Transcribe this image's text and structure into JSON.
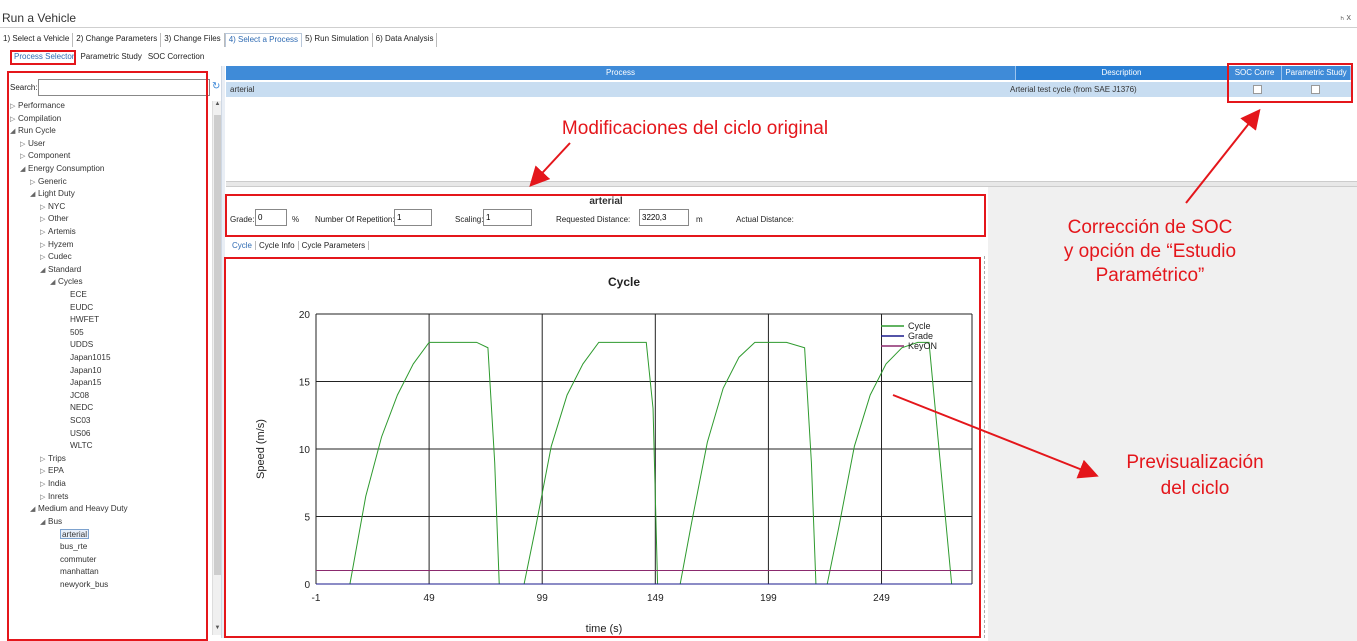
{
  "window": {
    "title": "Run a Vehicle",
    "controls": "ₕ x"
  },
  "main_tabs": [
    "1) Select a Vehicle",
    "2) Change Parameters",
    "3) Change Files",
    "4) Select a Process",
    "5) Run Simulation",
    "6) Data Analysis"
  ],
  "sub_tabs": [
    "Process Selector",
    "Parametric Study",
    "SOC Correction"
  ],
  "search": {
    "label": "Search:",
    "value": ""
  },
  "tree": [
    {
      "label": "Performance",
      "arrow": "▷",
      "level": 0
    },
    {
      "label": "Compilation",
      "arrow": "▷",
      "level": 0
    },
    {
      "label": "Run Cycle",
      "arrow": "◢",
      "level": 0
    },
    {
      "label": "User",
      "arrow": "▷",
      "level": 1
    },
    {
      "label": "Component",
      "arrow": "▷",
      "level": 1
    },
    {
      "label": "Energy Consumption",
      "arrow": "◢",
      "level": 1
    },
    {
      "label": "Generic",
      "arrow": "▷",
      "level": 2
    },
    {
      "label": "Light Duty",
      "arrow": "◢",
      "level": 2
    },
    {
      "label": "NYC",
      "arrow": "▷",
      "level": 3
    },
    {
      "label": "Other",
      "arrow": "▷",
      "level": 3
    },
    {
      "label": "Artemis",
      "arrow": "▷",
      "level": 3
    },
    {
      "label": "Hyzem",
      "arrow": "▷",
      "level": 3
    },
    {
      "label": "Cudec",
      "arrow": "▷",
      "level": 3
    },
    {
      "label": "Standard",
      "arrow": "◢",
      "level": 3
    },
    {
      "label": "Cycles",
      "arrow": "◢",
      "level": 4
    },
    {
      "label": "ECE",
      "arrow": "",
      "level": 6
    },
    {
      "label": "EUDC",
      "arrow": "",
      "level": 6
    },
    {
      "label": "HWFET",
      "arrow": "",
      "level": 6
    },
    {
      "label": "505",
      "arrow": "",
      "level": 6
    },
    {
      "label": "UDDS",
      "arrow": "",
      "level": 6
    },
    {
      "label": "Japan1015",
      "arrow": "",
      "level": 6
    },
    {
      "label": "Japan10",
      "arrow": "",
      "level": 6
    },
    {
      "label": "Japan15",
      "arrow": "",
      "level": 6
    },
    {
      "label": "JC08",
      "arrow": "",
      "level": 6
    },
    {
      "label": "NEDC",
      "arrow": "",
      "level": 6
    },
    {
      "label": "SC03",
      "arrow": "",
      "level": 6
    },
    {
      "label": "US06",
      "arrow": "",
      "level": 6
    },
    {
      "label": "WLTC",
      "arrow": "",
      "level": 6
    },
    {
      "label": "Trips",
      "arrow": "▷",
      "level": 3
    },
    {
      "label": "EPA",
      "arrow": "▷",
      "level": 3
    },
    {
      "label": "India",
      "arrow": "▷",
      "level": 3
    },
    {
      "label": "Inrets",
      "arrow": "▷",
      "level": 3
    },
    {
      "label": "Medium and Heavy Duty",
      "arrow": "◢",
      "level": 2
    },
    {
      "label": "Bus",
      "arrow": "◢",
      "level": 3
    },
    {
      "label": "arterial",
      "arrow": "",
      "level": 5,
      "selected": true
    },
    {
      "label": "bus_rte",
      "arrow": "",
      "level": 5
    },
    {
      "label": "commuter",
      "arrow": "",
      "level": 5
    },
    {
      "label": "manhattan",
      "arrow": "",
      "level": 5
    },
    {
      "label": "newyork_bus",
      "arrow": "",
      "level": 5
    }
  ],
  "grid": {
    "headers": {
      "process": "Process",
      "description": "Description",
      "soc": "SOC Corre",
      "parametric": "Parametric Study"
    },
    "row": {
      "process": "arterial",
      "description": "Arterial test cycle (from SAE J1376)"
    }
  },
  "params": {
    "title": "arterial",
    "grade_label": "Grade:",
    "grade_value": "0",
    "grade_unit": "%",
    "repetition_label": "Number Of Repetition:",
    "repetition_value": "1",
    "scaling_label": "Scaling:",
    "scaling_value": "1",
    "distance_label": "Requested Distance:",
    "distance_value": "3220,3",
    "distance_unit": "m",
    "actual_label": "Actual Distance:"
  },
  "chart_tabs": [
    "Cycle",
    "Cycle Info",
    "Cycle Parameters"
  ],
  "annotations": {
    "modificaciones": "Modificaciones del ciclo original",
    "correccion_1": "Corrección de SOC",
    "correccion_2": "y opción de “Estudio",
    "correccion_3": "Paramétrico”",
    "previsualizacion_1": "Previsualización",
    "previsualizacion_2": "del ciclo"
  },
  "colors": {
    "annotation": "#e4161b",
    "cycle": "#2e9a2e",
    "grade": "#1a1a8c",
    "keyon": "#8b2a6e",
    "header": "#3f8bd8",
    "row_selected": "#c8ddf1"
  },
  "chart_data": {
    "type": "line",
    "title": "Cycle",
    "xlabel": "time (s)",
    "ylabel": "Speed (m/s)",
    "xlim": [
      -1,
      289
    ],
    "ylim": [
      0,
      20
    ],
    "xticks": [
      -1,
      49,
      99,
      149,
      199,
      249
    ],
    "yticks": [
      0,
      5,
      10,
      15,
      20
    ],
    "grid": true,
    "legend_position": "top-right",
    "series": [
      {
        "name": "Cycle",
        "x": [
          14,
          21,
          28,
          35,
          42,
          49,
          56,
          63,
          70,
          75,
          78,
          80,
          85,
          88,
          91,
          96,
          103,
          110,
          117,
          124,
          131,
          138,
          145,
          148,
          150,
          155,
          160,
          165,
          172,
          179,
          186,
          193,
          200,
          207,
          215,
          218,
          220,
          225,
          230,
          237,
          244,
          251,
          258,
          265,
          270,
          280,
          284
        ],
        "y": [
          0,
          6.5,
          10.9,
          14,
          16.3,
          17.9,
          17.9,
          17.9,
          17.9,
          17.5,
          9,
          0,
          0,
          0,
          0,
          4.1,
          10.2,
          14,
          16.3,
          17.9,
          17.9,
          17.9,
          17.9,
          13,
          0,
          0,
          0,
          4.5,
          10.5,
          14.5,
          16.8,
          17.9,
          17.9,
          17.9,
          17.5,
          9,
          0,
          0,
          4.1,
          10.2,
          14,
          16.3,
          17.5,
          17.9,
          17.9,
          0,
          0
        ]
      },
      {
        "name": "Grade",
        "x": [
          -1,
          289
        ],
        "y": [
          0,
          0
        ]
      },
      {
        "name": "KeyON",
        "x": [
          -1,
          289
        ],
        "y": [
          1,
          1
        ]
      }
    ]
  }
}
